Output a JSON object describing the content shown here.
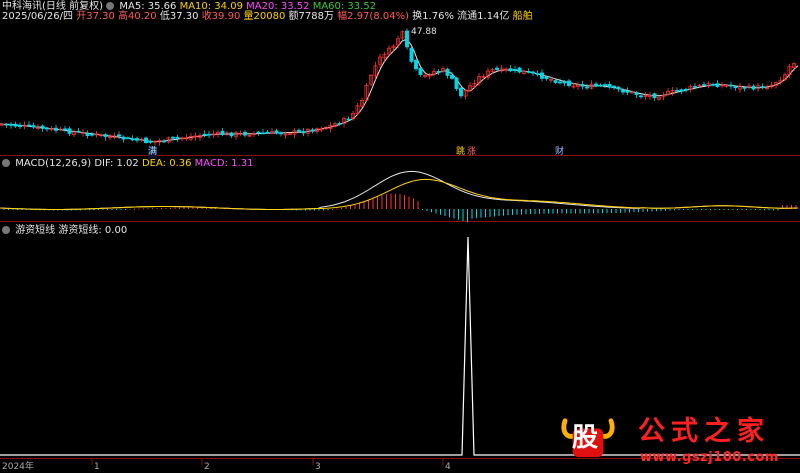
{
  "header": {
    "stock": "中科海讯(日线 前复权)",
    "ma5_label": "MA5: 35.66",
    "ma10_label": "MA10: 34.09",
    "ma20_label": "MA20: 33.52",
    "ma60_label": "MA60: 33.52"
  },
  "info": {
    "date": "2025/06/26/四",
    "open": "开37.30",
    "high": "高40.20",
    "low": "低37.30",
    "close": "收39.90",
    "volume": "量20080",
    "amount": "额7788万",
    "change": "幅2.97(8.04%)",
    "turnover": "换1.76%",
    "float_cap": "流通1.14亿",
    "sector": "船舶"
  },
  "annotations": {
    "peak": "47.88",
    "badge_left": "满",
    "badge_jump": "跳",
    "badge_rise": "涨",
    "badge_fin": "财"
  },
  "macd": {
    "title": "MACD(12,26,9)",
    "dif": "DIF: 1.02",
    "dea": "DEA: 0.36",
    "macd": "MACD: 1.31"
  },
  "indicator": {
    "name": "游资短线",
    "value_label": "游资短线: 0.00"
  },
  "time_axis": [
    "2024年",
    "1",
    "2",
    "3",
    "4"
  ],
  "watermark": {
    "char": "股",
    "title": "公式之家",
    "url": "www.gszj100.com"
  },
  "colors": {
    "up": "#ff3232",
    "down": "#00d7e6",
    "ma5": "#e6e6e6",
    "ma10": "#ffd200",
    "ma20": "#ff4cff",
    "ma60": "#3ec83e",
    "brand": "#ff2020"
  }
}
